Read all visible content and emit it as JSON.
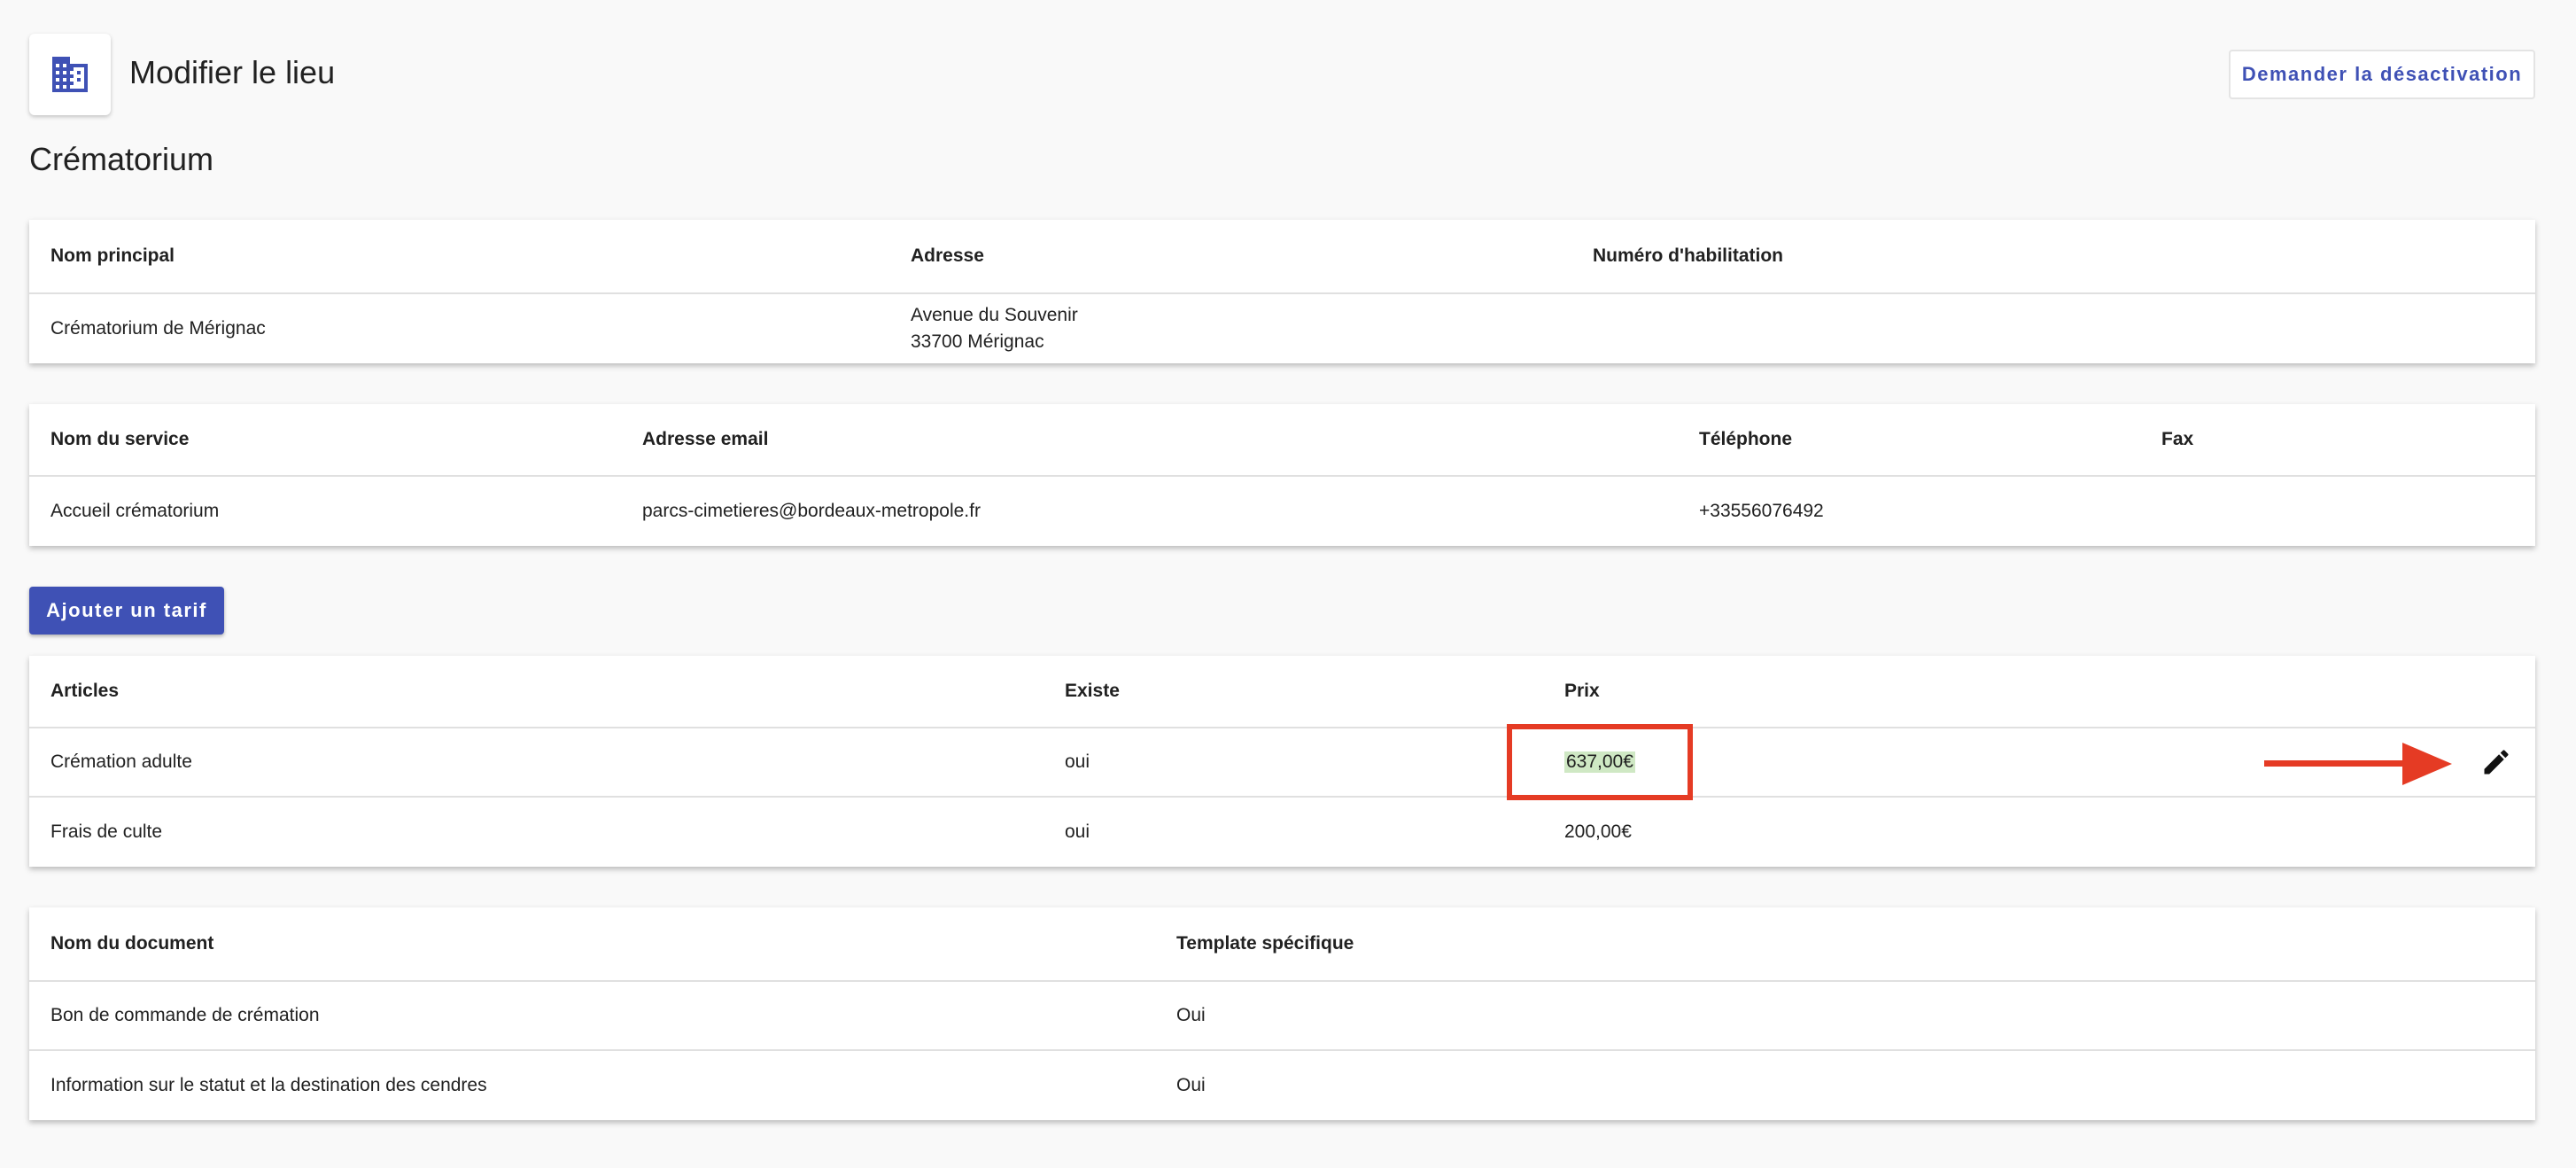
{
  "header": {
    "icon": "building-icon",
    "title": "Modifier le lieu",
    "deactivate_label": "Demander la désactivation"
  },
  "section_title": "Crématorium",
  "place_table": {
    "headers": [
      "Nom principal",
      "Adresse",
      "Numéro d'habilitation"
    ],
    "row": {
      "name": "Crématorium de Mérignac",
      "address_line1": "Avenue du Souvenir",
      "address_line2": "33700 Mérignac",
      "habilitation": ""
    }
  },
  "service_table": {
    "headers": [
      "Nom du service",
      "Adresse email",
      "Téléphone",
      "Fax"
    ],
    "row": {
      "service": "Accueil crématorium",
      "email": "parcs-cimetieres@bordeaux-metropole.fr",
      "phone": "+33556076492",
      "fax": ""
    }
  },
  "add_tariff_label": "Ajouter un tarif",
  "tariff_table": {
    "headers": [
      "Articles",
      "Existe",
      "Prix"
    ],
    "rows": [
      {
        "article": "Crémation adulte",
        "exists": "oui",
        "price": "637,00€"
      },
      {
        "article": "Frais de culte",
        "exists": "oui",
        "price": "200,00€"
      }
    ]
  },
  "documents_table": {
    "headers": [
      "Nom du document",
      "Template spécifique"
    ],
    "rows": [
      {
        "name": "Bon de commande de crémation",
        "template": "Oui"
      },
      {
        "name": "Information sur le statut et la destination des cendres",
        "template": "Oui"
      }
    ]
  },
  "colors": {
    "primary": "#3f51b5",
    "annotation_red": "#e53b24",
    "highlight_green": "#cfe8c4",
    "background": "#f9f9f9"
  },
  "icons": {
    "edit": "pencil-icon",
    "annotation": "arrow-right-icon"
  }
}
